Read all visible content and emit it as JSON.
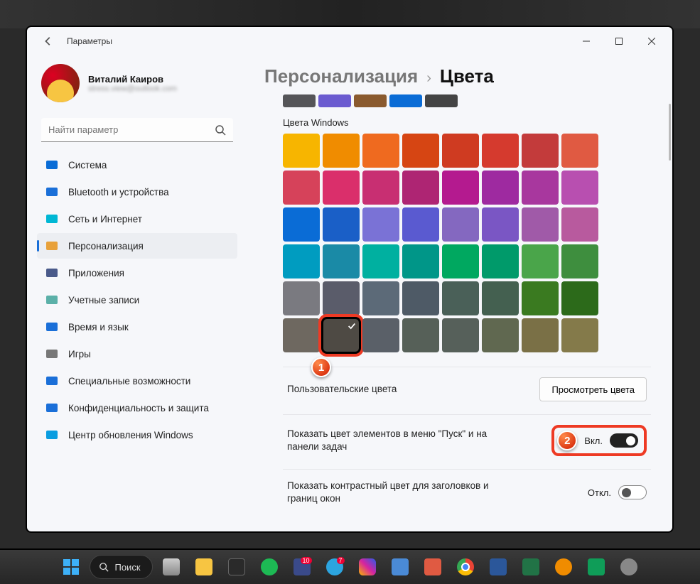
{
  "window": {
    "title": "Параметры",
    "user": {
      "name": "Виталий Каиров",
      "email": "stress.view@outlook.com"
    },
    "search": {
      "placeholder": "Найти параметр"
    }
  },
  "sidebar": {
    "items": [
      {
        "label": "Система",
        "icon": "system-icon",
        "color": "#0a6cd6"
      },
      {
        "label": "Bluetooth и устройства",
        "icon": "bluetooth-icon",
        "color": "#1a6fd8"
      },
      {
        "label": "Сеть и Интернет",
        "icon": "network-icon",
        "color": "#00b7d4"
      },
      {
        "label": "Персонализация",
        "icon": "personalization-icon",
        "color": "#e8a13a",
        "active": true
      },
      {
        "label": "Приложения",
        "icon": "apps-icon",
        "color": "#4a5a8a"
      },
      {
        "label": "Учетные записи",
        "icon": "accounts-icon",
        "color": "#5bb0a8"
      },
      {
        "label": "Время и язык",
        "icon": "time-language-icon",
        "color": "#1a6fd8"
      },
      {
        "label": "Игры",
        "icon": "gaming-icon",
        "color": "#777"
      },
      {
        "label": "Специальные возможности",
        "icon": "accessibility-icon",
        "color": "#1a6fd8"
      },
      {
        "label": "Конфиденциальность и защита",
        "icon": "privacy-icon",
        "color": "#1a6fd8"
      },
      {
        "label": "Центр обновления Windows",
        "icon": "windows-update-icon",
        "color": "#0a9de0"
      }
    ]
  },
  "breadcrumb": {
    "parent": "Персонализация",
    "current": "Цвета"
  },
  "prev_swatches": [
    "#555558",
    "#6b5bd0",
    "#8a5a2e",
    "#0a6cd6",
    "#444"
  ],
  "colors": {
    "section_label": "Цвета Windows",
    "grid": [
      [
        "#f7b500",
        "#f08c00",
        "#ef6a1f",
        "#d64513",
        "#cf3b21",
        "#d53a2e",
        "#c33b3b",
        "#e05a42"
      ],
      [
        "#d6425a",
        "#da2f6b",
        "#c82f72",
        "#ae2573",
        "#b41a8f",
        "#9e2aa0",
        "#a8379e",
        "#b84fb0"
      ],
      [
        "#0a6cd6",
        "#1a5fc7",
        "#7a72d6",
        "#5a5ad0",
        "#8468c0",
        "#7a56c4",
        "#a05aa8",
        "#b85a9e"
      ],
      [
        "#009cc0",
        "#1a8aa6",
        "#00b0a0",
        "#009688",
        "#00a860",
        "#009a6a",
        "#4aa54a",
        "#3e8e3e"
      ],
      [
        "#7a7a80",
        "#5a5c6a",
        "#5c6a78",
        "#4e5a66",
        "#4a6058",
        "#446050",
        "#3a7a20",
        "#2c6a1a"
      ],
      [
        "#6e6860",
        "#4e4a44",
        "#5a6068",
        "#566058",
        "#56605a",
        "#606850",
        "#7a7046",
        "#847a4a"
      ]
    ],
    "selected": {
      "row": 5,
      "col": 1
    }
  },
  "settings": {
    "custom_colors": {
      "label": "Пользовательские цвета",
      "button": "Просмотреть цвета"
    },
    "accent_start": {
      "label": "Показать цвет элементов в меню \"Пуск\" и на панели задач",
      "state_label": "Вкл.",
      "on": true
    },
    "accent_title": {
      "label": "Показать контрастный цвет для заголовков и границ окон",
      "state_label": "Откл.",
      "on": false
    }
  },
  "annotations": {
    "badge1": "1",
    "badge2": "2"
  },
  "taskbar": {
    "search_label": "Поиск"
  }
}
